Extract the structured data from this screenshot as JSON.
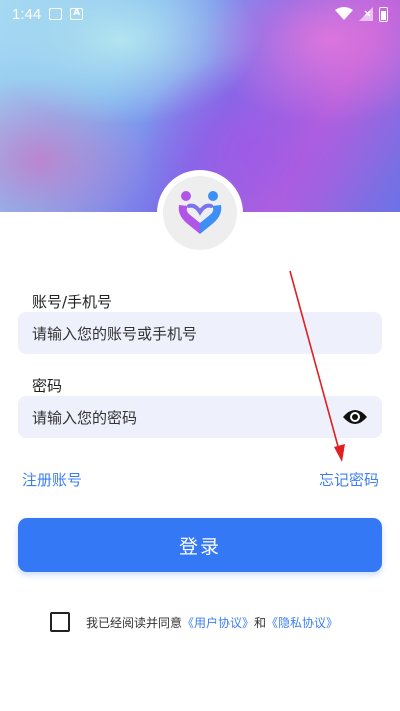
{
  "status_bar": {
    "time": "1:44",
    "icons": [
      "image-icon",
      "a-letter-icon",
      "wifi-icon",
      "signal-icon",
      "battery-icon"
    ]
  },
  "logo": {
    "icon": "couple-heart-logo-icon",
    "colors": {
      "purple": "#b055e8",
      "blue": "#3d8ef5"
    }
  },
  "form": {
    "account_label": "账号/手机号",
    "account_placeholder": "请输入您的账号或手机号",
    "password_label": "密码",
    "password_placeholder": "请输入您的密码",
    "show_password_icon": "eye-icon"
  },
  "links": {
    "register": "注册账号",
    "forgot": "忘记密码"
  },
  "login_button": "登录",
  "agreement": {
    "prefix": "我已经阅读并同意",
    "user_agreement": "《用户协议》",
    "and": "和",
    "privacy_agreement": "《隐私协议》"
  },
  "colors": {
    "accent": "#3478f6",
    "link": "#3e7ff0",
    "field_bg": "#eef0fb",
    "annotation_arrow": "#e02020"
  }
}
